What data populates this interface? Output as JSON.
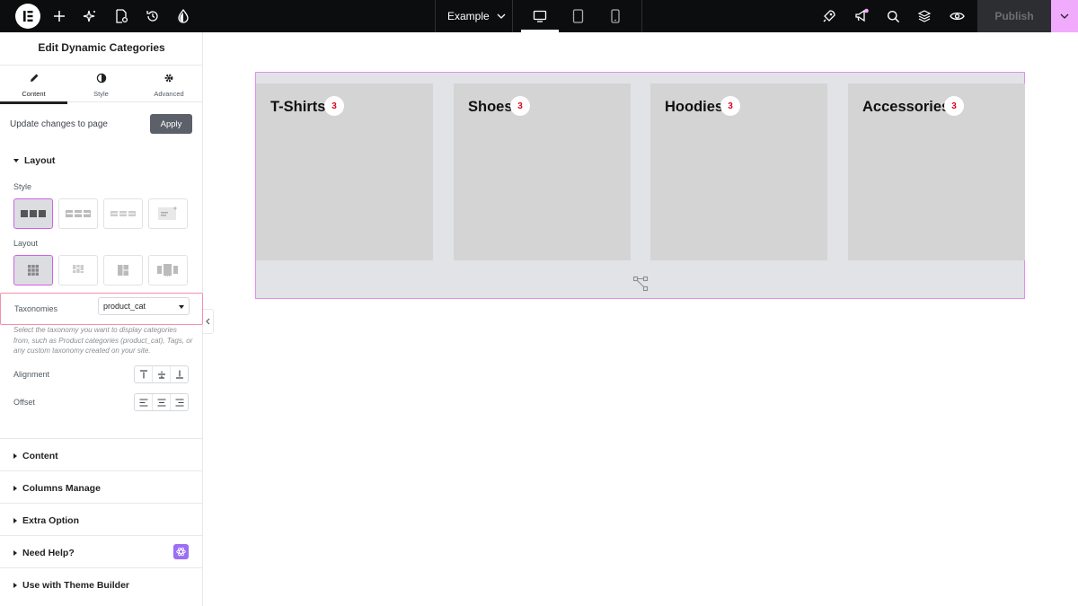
{
  "topbar": {
    "document_title": "Example",
    "publish_label": "Publish",
    "icons": [
      "elementor-logo-icon",
      "add-icon",
      "ai-sparkle-icon",
      "page-settings-icon",
      "history-icon",
      "site-style-icon",
      "desktop-icon",
      "tablet-icon",
      "mobile-icon",
      "apps-rocket-icon",
      "notifications-megaphone-icon",
      "search-icon",
      "structure-layers-icon",
      "preview-eye-icon",
      "chevron-down-icon"
    ]
  },
  "panel": {
    "title": "Edit Dynamic Categories",
    "tabs": [
      {
        "label": "Content",
        "icon": "pencil-icon"
      },
      {
        "label": "Style",
        "icon": "half-circle-icon"
      },
      {
        "label": "Advanced",
        "icon": "gear-icon"
      }
    ],
    "update_text": "Update changes to page",
    "apply_label": "Apply",
    "layout_section": {
      "title": "Layout",
      "style_label": "Style",
      "layout_label": "Layout",
      "taxonomies_label": "Taxonomies",
      "taxonomies_value": "product_cat",
      "taxonomies_help": "Select the taxonomy you want to display categories from, such as Product categories (product_cat), Tags, or any custom taxonomy created on your site.",
      "alignment_label": "Alignment",
      "offset_label": "Offset"
    },
    "sections": [
      "Content",
      "Columns Manage",
      "Extra Option",
      "Need Help?",
      "Use with Theme Builder"
    ]
  },
  "canvas": {
    "categories": [
      {
        "name": "T-Shirts",
        "count": "3"
      },
      {
        "name": "Shoes",
        "count": "3"
      },
      {
        "name": "Hoodies",
        "count": "3"
      },
      {
        "name": "Accessories",
        "count": "3"
      }
    ]
  },
  "colors": {
    "accent": "#d061e6",
    "count_text": "#e0001a",
    "card_bg": "#d4d4d4",
    "topbar_bg": "#0c0d0e"
  }
}
